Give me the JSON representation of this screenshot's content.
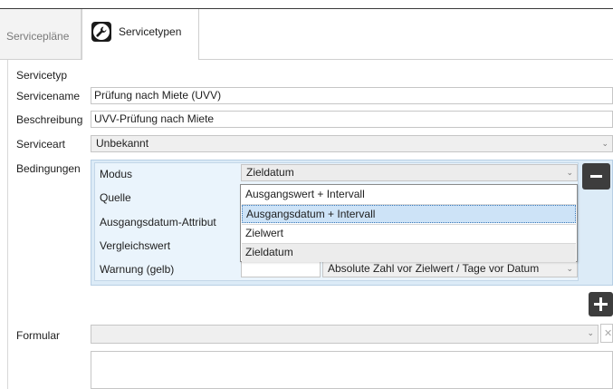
{
  "tabs": [
    {
      "label": "Servicepläne",
      "active": false
    },
    {
      "label": "Servicetypen",
      "active": true,
      "icon": "wrench-icon"
    }
  ],
  "form": {
    "servicetyp_label": "Servicetyp",
    "servicename_label": "Servicename",
    "servicename_value": "Prüfung nach Miete (UVV)",
    "beschreibung_label": "Beschreibung",
    "beschreibung_value": "UVV-Prüfung nach Miete",
    "serviceart_label": "Serviceart",
    "serviceart_value": "Unbekannt",
    "bedingungen_label": "Bedingungen",
    "formular_label": "Formular",
    "formular_value": ""
  },
  "conditions": {
    "modus_label": "Modus",
    "modus_value": "Zieldatum",
    "quelle_label": "Quelle",
    "ausgangsdatum_label": "Ausgangsdatum-Attribut",
    "vergleichswert_label": "Vergleichswert",
    "warnung_label": "Warnung (gelb)",
    "warnung_value": "",
    "warnung_mode": "Absolute Zahl vor Zielwert / Tage vor Datum"
  },
  "dropdown": {
    "options": [
      "Ausgangswert + Intervall",
      "Ausgangsdatum + Intervall",
      "Zielwert",
      "Zieldatum"
    ],
    "highlighted": "Ausgangsdatum + Intervall",
    "selected": "Zieldatum"
  },
  "colors": {
    "conditions_bg": "#dcebf7",
    "highlight": "#cde3f7",
    "button_dark": "#3d3d3d"
  }
}
